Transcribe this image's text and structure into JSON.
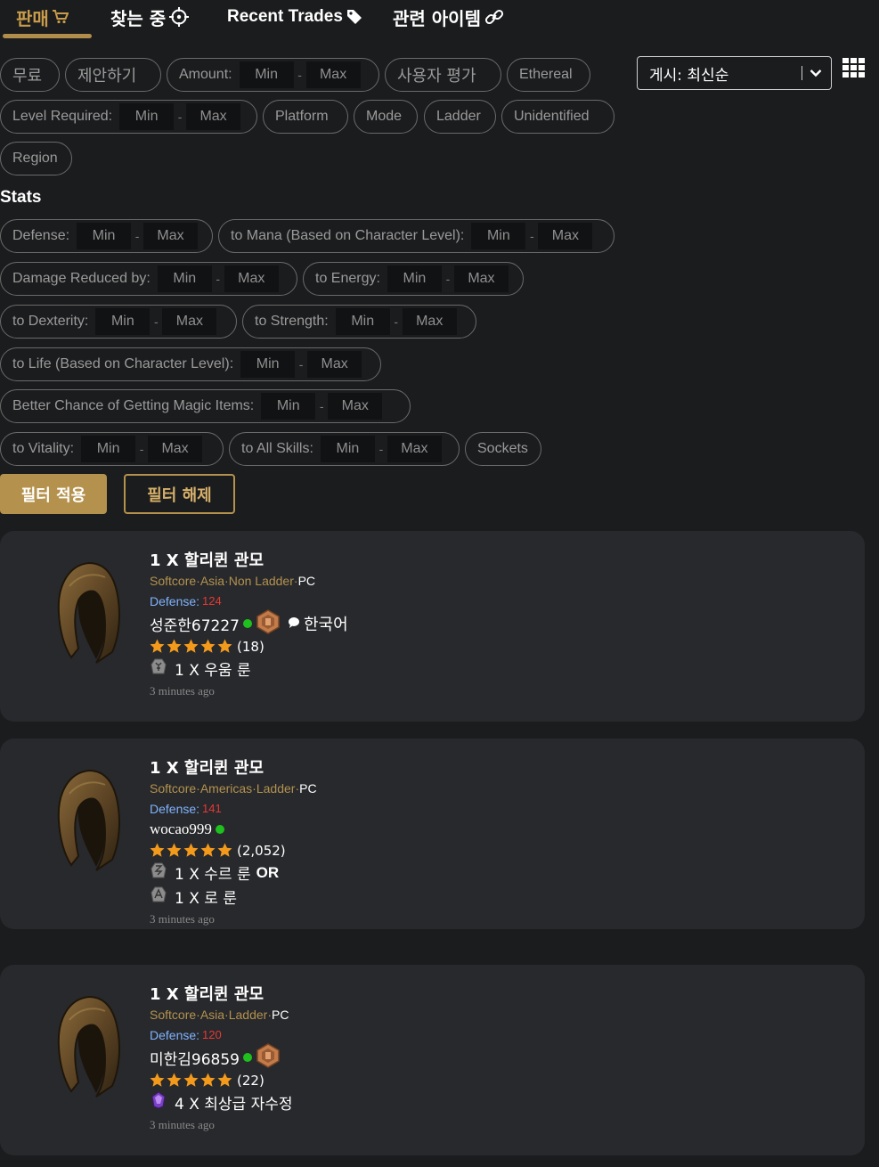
{
  "tabs": [
    {
      "label": "판매",
      "icon": "cart-icon",
      "active": true
    },
    {
      "label": "찾는 중",
      "icon": "crosshair-icon",
      "active": false
    },
    {
      "label": "Recent Trades",
      "icon": "tag-icon",
      "active": false
    },
    {
      "label": "관련 아이템",
      "icon": "link-icon",
      "active": false
    }
  ],
  "filters": {
    "free": "무료",
    "offer": "제안하기",
    "amount": {
      "label": "Amount:",
      "min": "Min",
      "max": "Max"
    },
    "user_rating": "사용자 평가",
    "ethereal": "Ethereal",
    "level_required": {
      "label": "Level Required:",
      "min": "Min",
      "max": "Max"
    },
    "platform": "Platform",
    "mode": "Mode",
    "ladder": "Ladder",
    "unidentified": "Unidentified",
    "region": "Region",
    "range_sep": "-"
  },
  "sort": {
    "label": "게시: 최신순",
    "icon": "chevron-down-icon"
  },
  "stats": {
    "title": "Stats",
    "defense": "Defense:",
    "mana": "to Mana (Based on Character Level):",
    "damage_reduced": "Damage Reduced by:",
    "energy": "to Energy:",
    "dexterity": "to Dexterity:",
    "strength": "to Strength:",
    "life": "to Life (Based on Character Level):",
    "magic_find": "Better Chance of Getting Magic Items:",
    "vitality": "to Vitality:",
    "all_skills": "to All Skills:",
    "sockets": "Sockets",
    "min": "Min",
    "max": "Max"
  },
  "buttons": {
    "apply": "필터 적용",
    "clear": "필터 해제"
  },
  "listings": [
    {
      "title": "1 X 할리퀸 관모",
      "mode": "Softcore",
      "region": "Asia",
      "ladder": "Non Ladder",
      "platform": "PC",
      "defense_label": "Defense:",
      "defense": "124",
      "seller": "성준한67227",
      "language": "한국어",
      "rating": 5,
      "reviews": "(18)",
      "price": [
        "1 X 우움 룬"
      ],
      "price_or": "",
      "time": "3 minutes ago"
    },
    {
      "title": "1 X 할리퀸 관모",
      "mode": "Softcore",
      "region": "Americas",
      "ladder": "Ladder",
      "platform": "PC",
      "defense_label": "Defense:",
      "defense": "141",
      "seller": "wocao999",
      "language": "",
      "rating": 5,
      "reviews": "(2,052)",
      "price": [
        "1 X 수르 룬",
        "1 X 로 룬"
      ],
      "price_or": "OR",
      "time": "3 minutes ago"
    },
    {
      "title": "1 X 할리퀸 관모",
      "mode": "Softcore",
      "region": "Asia",
      "ladder": "Ladder",
      "platform": "PC",
      "defense_label": "Defense:",
      "defense": "120",
      "seller": "미한김96859",
      "language": "",
      "rating": 5,
      "reviews": "(22)",
      "price": [
        "4 X 최상급 자수정"
      ],
      "price_or": "",
      "time": "3 minutes ago"
    }
  ],
  "meta_sep": " · ",
  "colors": {
    "accent": "#b4914c",
    "background": "#1b1c1e",
    "card": "#28292c",
    "online": "#1ec01e",
    "defense_value": "#e53935",
    "star": "#f39a1c"
  }
}
